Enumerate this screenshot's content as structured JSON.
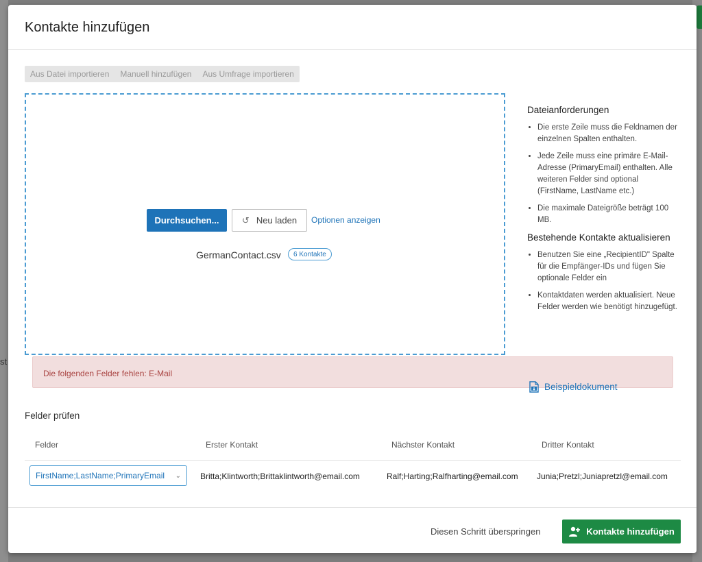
{
  "modal": {
    "title": "Kontakte hinzufügen"
  },
  "tabs": [
    {
      "label": "Aus Datei importieren"
    },
    {
      "label": "Manuell hinzufügen"
    },
    {
      "label": "Aus Umfrage importieren"
    }
  ],
  "upload": {
    "browse_label": "Durchsuchen...",
    "reload_label": "Neu laden",
    "options_label": "Optionen anzeigen",
    "filename": "GermanContact.csv",
    "contacts_badge": "6 Kontakte"
  },
  "error": {
    "text": "Die folgenden Felder fehlen: E-Mail"
  },
  "requirements": {
    "title": "Dateianforderungen",
    "items": [
      "Die erste Zeile muss die Feldnamen der einzelnen Spalten enthalten.",
      "Jede Zeile muss eine primäre E-Mail-Adresse (PrimaryEmail) enthalten. Alle weiteren Felder sind optional (FirstName, LastName etc.)",
      "Die maximale Dateigröße beträgt 100 MB."
    ],
    "update_title": "Bestehende Kontakte aktualisieren",
    "update_items": [
      "Benutzen Sie eine „RecipientID\" Spalte für die Empfänger-IDs und fügen Sie optionale Felder ein",
      "Kontaktdaten werden aktualisiert. Neue Felder werden wie benötigt hinzugefügt."
    ],
    "sample_link": "Beispieldokument"
  },
  "check": {
    "title": "Felder prüfen",
    "columns": [
      "Felder",
      "Erster Kontakt",
      "Nächster Kontakt",
      "Dritter Kontakt"
    ],
    "row": {
      "field_value": "FirstName;LastName;PrimaryEmail",
      "first": "Britta;Klintworth;Brittaklintworth@email.com",
      "next": "Ralf;Harting;Ralfharting@email.com",
      "third": "Junia;Pretzl;Juniapretzl@email.com"
    }
  },
  "footer": {
    "skip_label": "Diesen Schritt überspringen",
    "add_label": "Kontakte hinzufügen"
  },
  "colors": {
    "primary": "#1e73b8",
    "success": "#1d8a44",
    "error_bg": "#f2dede",
    "error_text": "#a94442"
  },
  "background": {
    "left_glyph": "st"
  }
}
